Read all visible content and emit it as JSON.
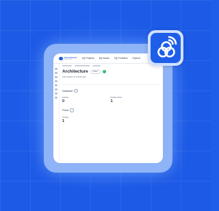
{
  "app": {
    "brand_name": "ServerGuard",
    "brand_sub": "Cloud Suite"
  },
  "nav": {
    "items": [
      "My Projects",
      "My Issues",
      "My Portfolios",
      "Explore"
    ]
  },
  "page": {
    "title": "Architecture",
    "status_pill": "Stable",
    "subline": "Last analysis 12 minutes ago"
  },
  "sections": [
    {
      "title": "Database",
      "stats": [
        {
          "label": "Entities",
          "value": "0"
        },
        {
          "label": "Relationships",
          "value": "1"
        }
      ]
    },
    {
      "title": "Flows",
      "stats": [
        {
          "label": "Targets",
          "value": "1"
        }
      ]
    }
  ],
  "badge": {
    "icon": "cloud-sync-icon"
  },
  "colors": {
    "background": "#1f5ee8",
    "accent": "#1f5ee8",
    "success": "#2bb673"
  }
}
